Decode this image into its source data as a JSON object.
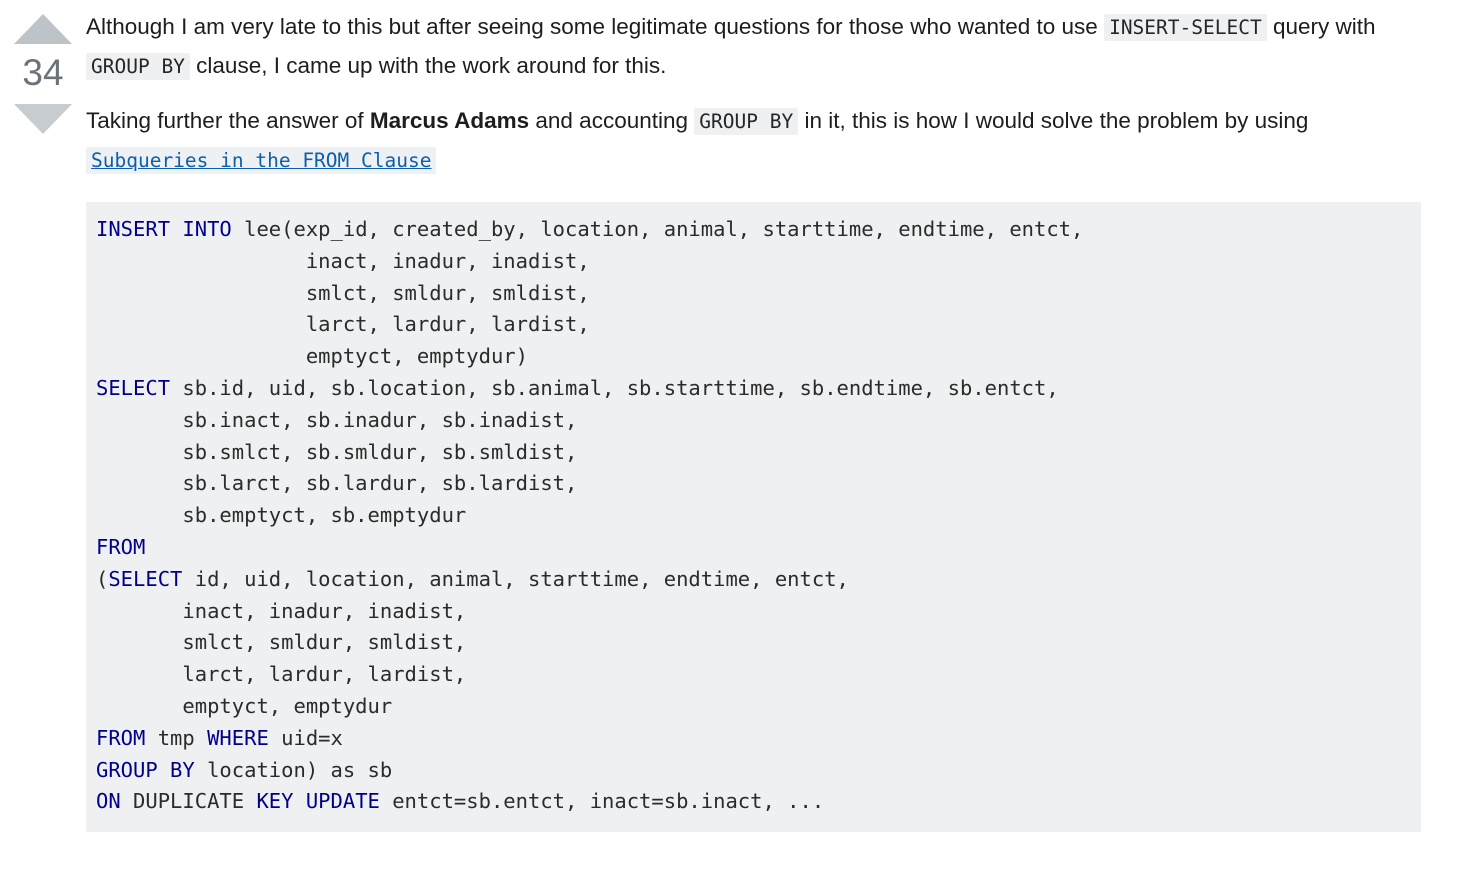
{
  "vote": {
    "up_icon": "triangle-up-icon",
    "down_icon": "triangle-down-icon",
    "count": "34"
  },
  "post": {
    "paragraph1": {
      "part1": "Although I am very late to this but after seeing some legitimate questions for those who wanted to use ",
      "code1": "INSERT-SELECT",
      "part2": " query with ",
      "code2": "GROUP BY",
      "part3": " clause, I came up with the work around for this."
    },
    "paragraph2": {
      "part1": "Taking further the answer of ",
      "bold1": "Marcus Adams",
      "part2": " and accounting ",
      "code1": "GROUP BY",
      "part3": " in it, this is how I would solve the problem by using ",
      "link1": "Subqueries in the FROM Clause"
    }
  },
  "code_block": {
    "language": "sql",
    "lines": [
      [
        {
          "t": "INSERT INTO ",
          "c": "kw"
        },
        {
          "t": "lee(exp_id, created_by, location, animal, starttime, endtime, entct,",
          "c": "pl"
        }
      ],
      [
        {
          "t": "                 inact, inadur, inadist,",
          "c": "pl"
        }
      ],
      [
        {
          "t": "                 smlct, smldur, smldist,",
          "c": "pl"
        }
      ],
      [
        {
          "t": "                 larct, lardur, lardist,",
          "c": "pl"
        }
      ],
      [
        {
          "t": "                 emptyct, emptydur)",
          "c": "pl"
        }
      ],
      [
        {
          "t": "SELECT ",
          "c": "kw"
        },
        {
          "t": "sb.id, uid, sb.location, sb.animal, sb.starttime, sb.endtime, sb.entct,",
          "c": "pl"
        }
      ],
      [
        {
          "t": "       sb.inact, sb.inadur, sb.inadist,",
          "c": "pl"
        }
      ],
      [
        {
          "t": "       sb.smlct, sb.smldur, sb.smldist,",
          "c": "pl"
        }
      ],
      [
        {
          "t": "       sb.larct, sb.lardur, sb.lardist,",
          "c": "pl"
        }
      ],
      [
        {
          "t": "       sb.emptyct, sb.emptydur",
          "c": "pl"
        }
      ],
      [
        {
          "t": "FROM",
          "c": "kw"
        }
      ],
      [
        {
          "t": "(",
          "c": "pl"
        },
        {
          "t": "SELECT ",
          "c": "kw"
        },
        {
          "t": "id, uid, location, animal, starttime, endtime, entct,",
          "c": "pl"
        }
      ],
      [
        {
          "t": "       inact, inadur, inadist,",
          "c": "pl"
        }
      ],
      [
        {
          "t": "       smlct, smldur, smldist,",
          "c": "pl"
        }
      ],
      [
        {
          "t": "       larct, lardur, lardist,",
          "c": "pl"
        }
      ],
      [
        {
          "t": "       emptyct, emptydur",
          "c": "pl"
        }
      ],
      [
        {
          "t": "FROM ",
          "c": "kw"
        },
        {
          "t": "tmp ",
          "c": "pl"
        },
        {
          "t": "WHERE ",
          "c": "kw"
        },
        {
          "t": "uid=x",
          "c": "pl"
        }
      ],
      [
        {
          "t": "GROUP BY ",
          "c": "kw"
        },
        {
          "t": "location) as sb",
          "c": "pl"
        }
      ],
      [
        {
          "t": "ON ",
          "c": "kw"
        },
        {
          "t": "DUPLICATE ",
          "c": "pl"
        },
        {
          "t": "KEY UPDATE ",
          "c": "kw"
        },
        {
          "t": "entct=sb.entct, inact=sb.inact, ...",
          "c": "pl"
        }
      ]
    ]
  },
  "colors": {
    "keyword": "#00008b",
    "code_bg": "#eff0f1",
    "link": "#0c5fad",
    "vote_count": "#6a737c",
    "arrow": "#bdc3c7"
  }
}
